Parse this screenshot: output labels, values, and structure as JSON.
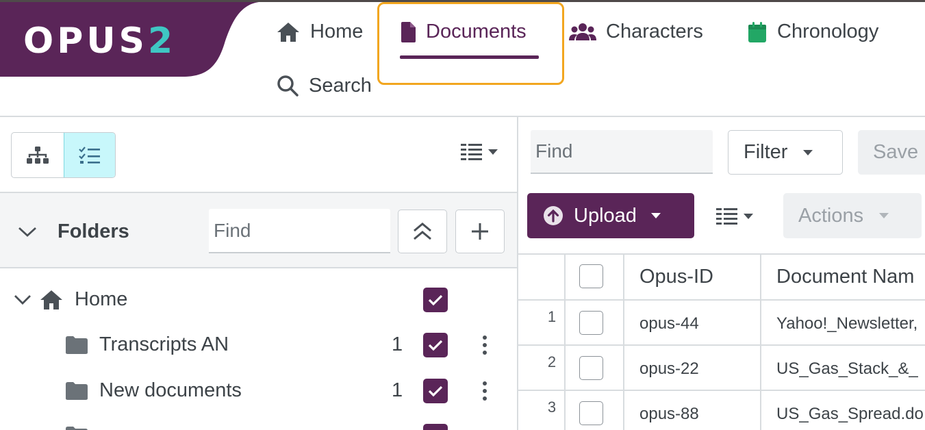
{
  "app": {
    "logo_main": "OPUS",
    "logo_accent": "2",
    "colors": {
      "brand": "#5a2558",
      "accent": "#3fc6c3",
      "highlight": "#f2a61f",
      "toggle_active": "#c8f7fb"
    }
  },
  "nav": {
    "home": {
      "label": "Home",
      "icon": "home-icon"
    },
    "documents": {
      "label": "Documents",
      "icon": "document-icon"
    },
    "characters": {
      "label": "Characters",
      "icon": "users-icon"
    },
    "chronology": {
      "label": "Chronology",
      "icon": "calendar-icon"
    },
    "search": {
      "label": "Search",
      "icon": "search-icon"
    },
    "active": "documents"
  },
  "left": {
    "folders_title": "Folders",
    "find_placeholder": "Find",
    "tree": [
      {
        "label": "Home",
        "count": "",
        "checked": true
      },
      {
        "label": "Transcripts AN",
        "count": "1",
        "checked": true
      },
      {
        "label": "New documents",
        "count": "1",
        "checked": true
      }
    ]
  },
  "right": {
    "find_placeholder": "Find",
    "filter_label": "Filter",
    "save_label": "Save",
    "upload_label": "Upload",
    "actions_label": "Actions",
    "columns": {
      "opus_id": "Opus-ID",
      "document_name": "Document Nam"
    },
    "rows": [
      {
        "num": "1",
        "opus_id": "opus-44",
        "name": "Yahoo!_Newsletter,"
      },
      {
        "num": "2",
        "opus_id": "opus-22",
        "name": "US_Gas_Stack_&_"
      },
      {
        "num": "3",
        "opus_id": "opus-88",
        "name": "US_Gas_Spread.do"
      }
    ]
  }
}
